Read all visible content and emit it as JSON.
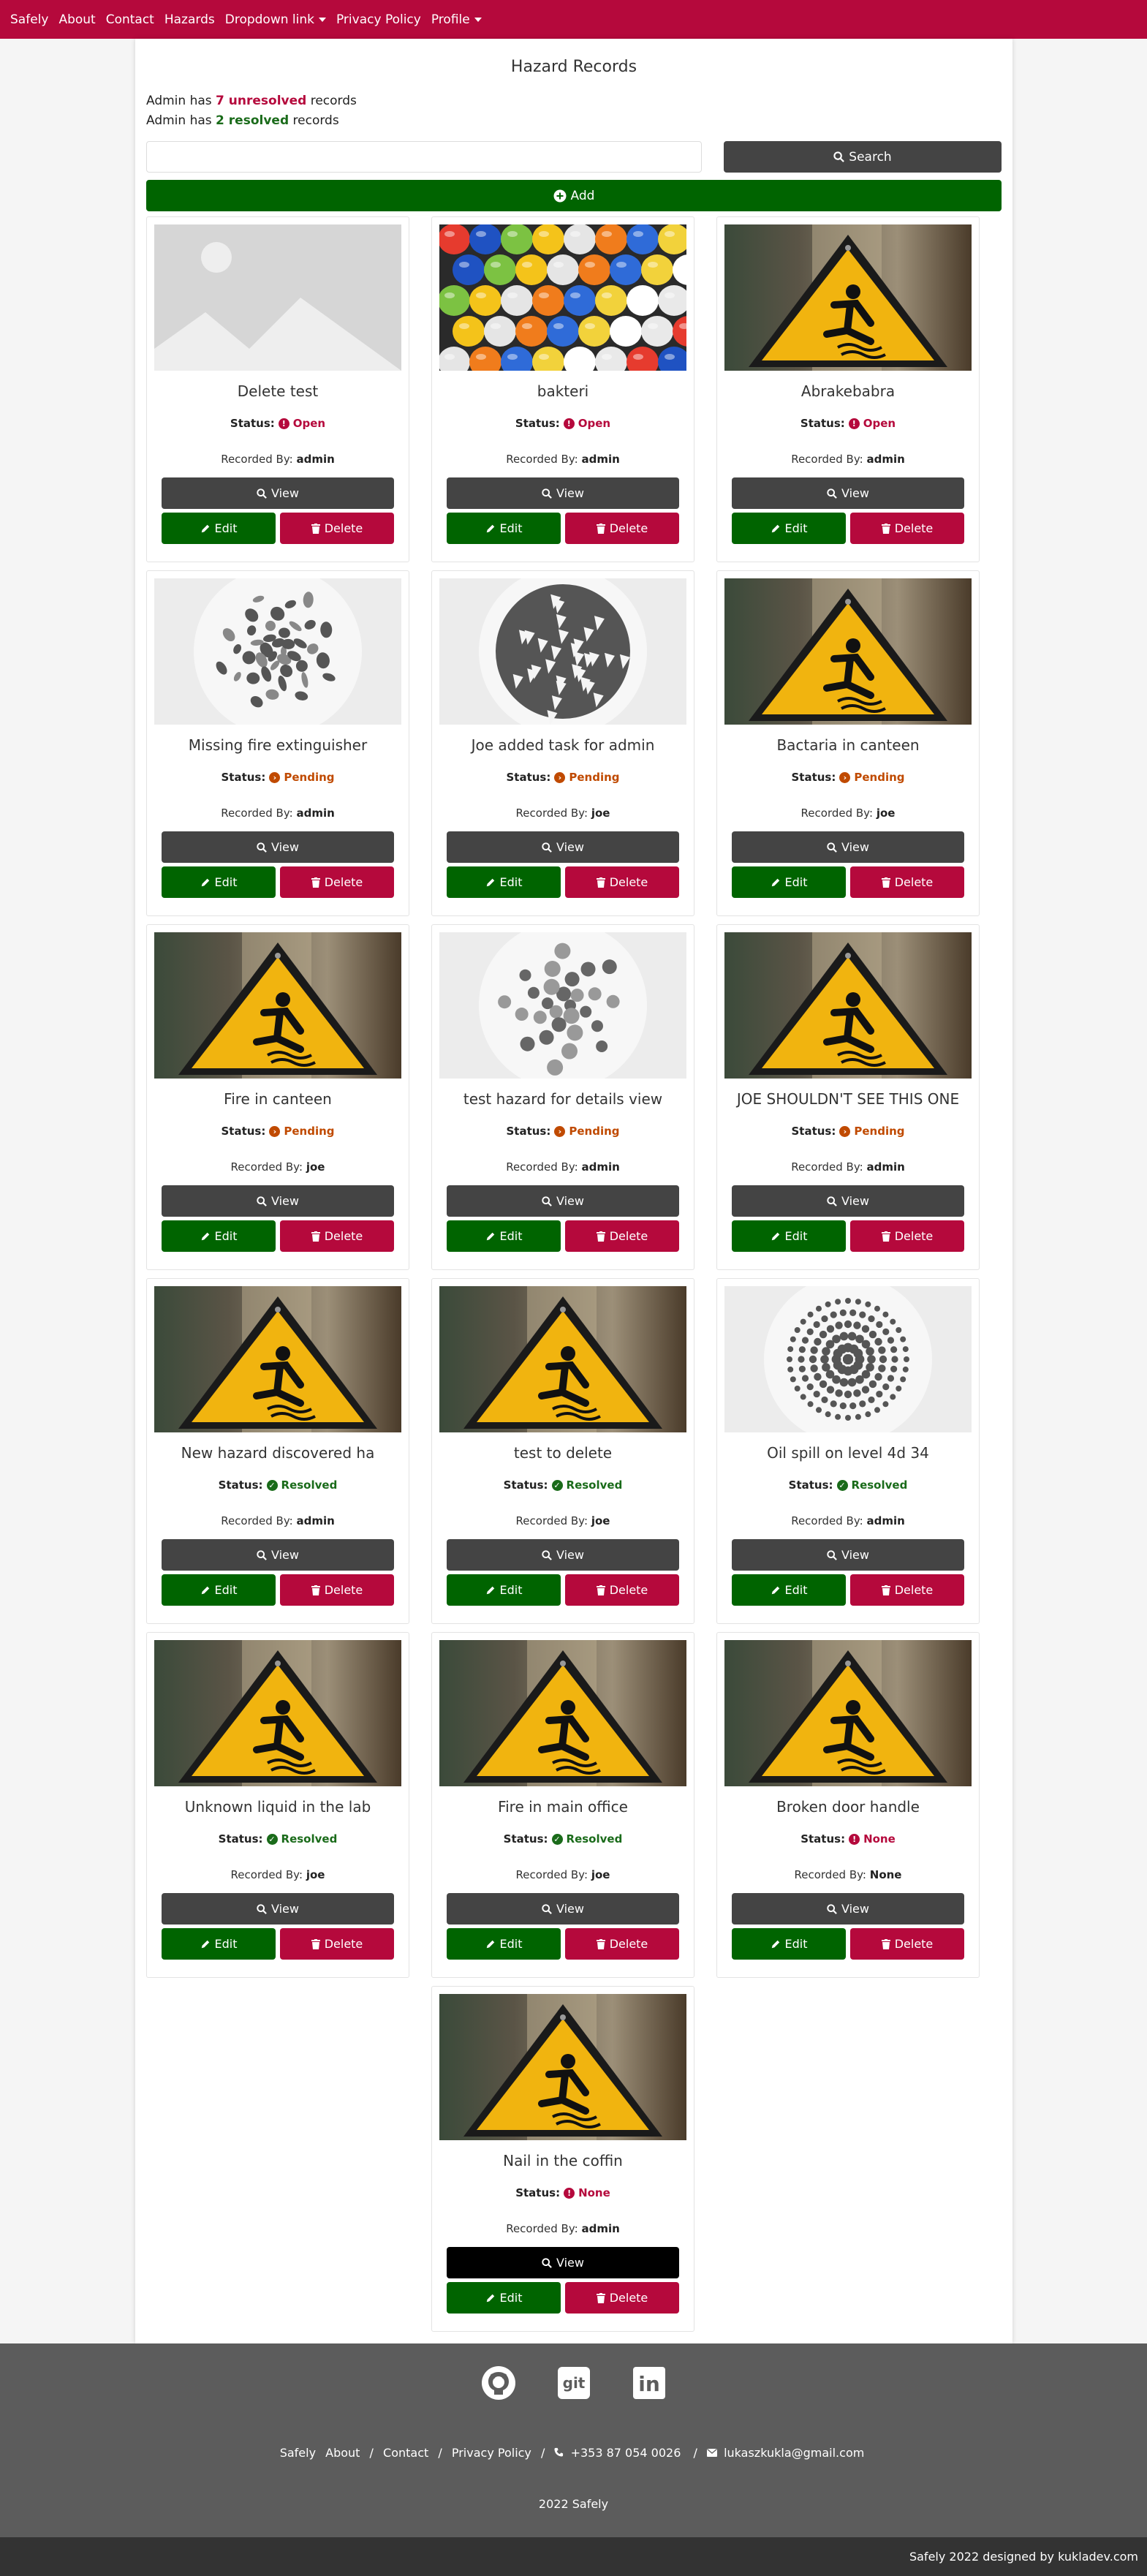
{
  "colors": {
    "brand": "#b5093c",
    "success": "#006400",
    "dark": "#444444",
    "footer": "#5c5c5c",
    "open": "#b5093c",
    "pending": "#c04a00",
    "resolved": "#1a6b1a"
  },
  "nav": {
    "items": [
      {
        "label": "Safely"
      },
      {
        "label": "About"
      },
      {
        "label": "Contact"
      },
      {
        "label": "Hazards"
      },
      {
        "label": "Dropdown link"
      },
      {
        "label": "Privacy Policy"
      },
      {
        "label": "Profile"
      }
    ]
  },
  "page": {
    "title": "Hazard Records",
    "stats": {
      "prefix": "Admin has",
      "unresolved": "7 unresolved",
      "resolved": "2 resolved",
      "suffix": "records"
    },
    "search": {
      "placeholder": "",
      "button": "Search"
    },
    "add_button": "Add"
  },
  "labels": {
    "status": "Status:",
    "recorded_by": "Recorded By:",
    "view": "View",
    "edit": "Edit",
    "delete": "Delete"
  },
  "hazards": [
    {
      "title": "Delete test",
      "status": "Open",
      "recorded_by": "admin",
      "image": "placeholder-image"
    },
    {
      "title": "bakteri",
      "status": "Open",
      "recorded_by": "admin",
      "image": "hard-hats-photo"
    },
    {
      "title": "Abrakebabra",
      "status": "Open",
      "recorded_by": "admin",
      "image": "wet-floor-sign-photo"
    },
    {
      "title": "Missing fire extinguisher",
      "status": "Pending",
      "recorded_by": "admin",
      "image": "drops-pattern"
    },
    {
      "title": "Joe added task for admin",
      "status": "Pending",
      "recorded_by": "joe",
      "image": "shards-pattern"
    },
    {
      "title": "Bactaria in canteen",
      "status": "Pending",
      "recorded_by": "joe",
      "image": "wet-floor-sign-photo"
    },
    {
      "title": "Fire in canteen",
      "status": "Pending",
      "recorded_by": "joe",
      "image": "wet-floor-sign-photo"
    },
    {
      "title": "test hazard for details view",
      "status": "Pending",
      "recorded_by": "admin",
      "image": "flower-pattern"
    },
    {
      "title": "JOE SHOULDN'T SEE THIS ONE",
      "status": "Pending",
      "recorded_by": "admin",
      "image": "wet-floor-sign-photo"
    },
    {
      "title": "New hazard discovered ha",
      "status": "Resolved",
      "recorded_by": "admin",
      "image": "wet-floor-sign-photo"
    },
    {
      "title": "test to delete",
      "status": "Resolved",
      "recorded_by": "joe",
      "image": "wet-floor-sign-photo"
    },
    {
      "title": "Oil spill on level 4d 34",
      "status": "Resolved",
      "recorded_by": "admin",
      "image": "dots-pattern"
    },
    {
      "title": "Unknown liquid in the lab",
      "status": "Resolved",
      "recorded_by": "joe",
      "image": "wet-floor-sign-photo"
    },
    {
      "title": "Fire in main office",
      "status": "Resolved",
      "recorded_by": "joe",
      "image": "wet-floor-sign-photo"
    },
    {
      "title": "Broken door handle",
      "status": "None",
      "recorded_by": "None",
      "image": "wet-floor-sign-photo"
    },
    {
      "title": "Nail in the coffin",
      "status": "None",
      "recorded_by": "admin",
      "image": "wet-floor-sign-photo"
    }
  ],
  "footer": {
    "icons": [
      "github-icon",
      "git-icon",
      "linkedin-icon"
    ],
    "git_text": "git",
    "linkedin_text": "in",
    "links": [
      "Safely",
      "About",
      "Contact",
      "Privacy Policy"
    ],
    "phone": "+353 87 054 0026",
    "email": "lukaszkukla@gmail.com",
    "copyright": "2022 Safely",
    "credit": "Safely 2022 designed by kukladev.com"
  }
}
